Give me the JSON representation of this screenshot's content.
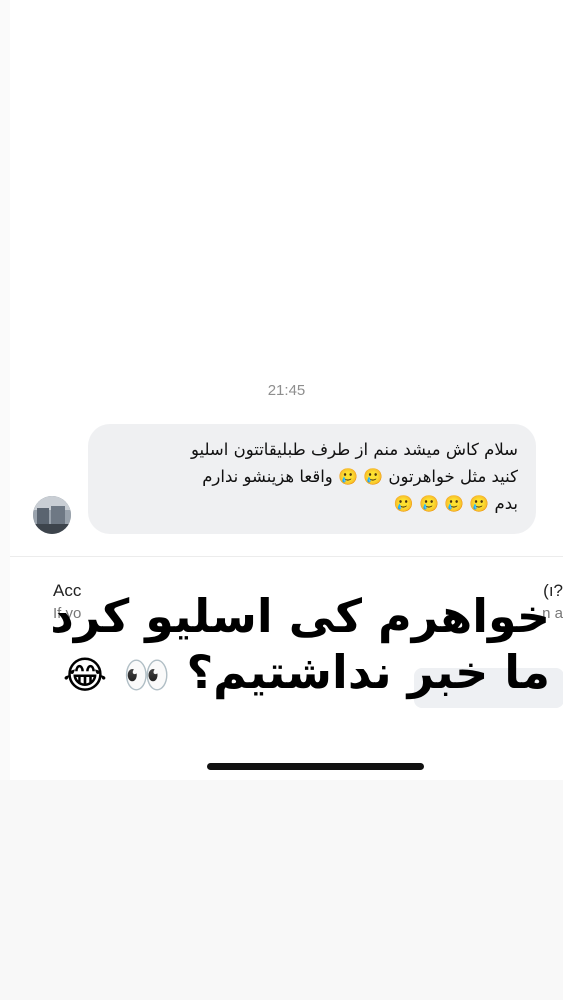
{
  "chat": {
    "timestamp": "21:45",
    "message": {
      "line1": "سلام کاش میشد منم  از  طرف طبلیقاتتون اسلیو",
      "line2_text": "کنید مثل خواهرتون",
      "line2_text_b": "واقعا هزینشو ندارم",
      "line3_text": "بدم",
      "emoji_cry": "🥲",
      "emoji_tear": "😢"
    }
  },
  "banner": {
    "left_title": "Acc",
    "left_subtitle": "If yo",
    "right_title": "(ı?",
    "right_subtitle": "n a"
  },
  "overlay": {
    "line1": "خواهرم کی اسلیو کرد",
    "line2": "ما خبر نداشتیم؟",
    "emoji_eyes": "👀",
    "emoji_laugh": "😂"
  },
  "colors": {
    "bubble": "#eff0f2",
    "background": "#ffffff",
    "timestamp": "#8e8e8e"
  },
  "icons": {
    "avatar": "profile-photo"
  }
}
